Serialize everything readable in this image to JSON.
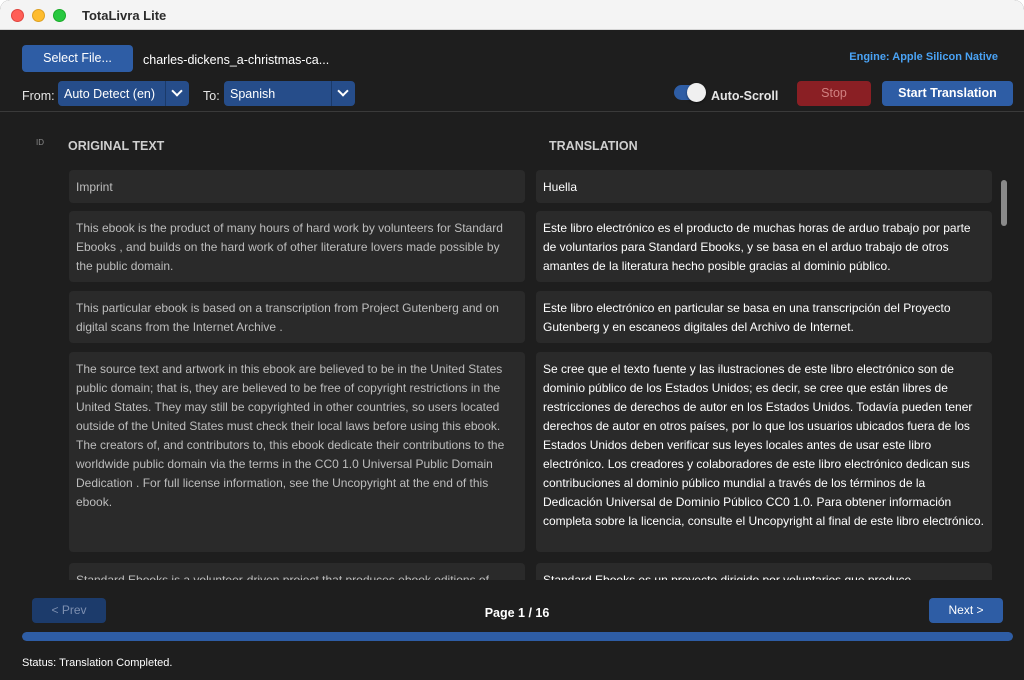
{
  "window": {
    "title": "TotaLivra Lite"
  },
  "toolbar": {
    "select_file_label": "Select File...",
    "filename": "charles-dickens_a-christmas-ca...",
    "engine_label": "Engine: Apple Silicon Native",
    "from_label": "From:",
    "from_value": "Auto Detect (en)",
    "to_label": "To:",
    "to_value": "Spanish",
    "autoscroll_label": "Auto-Scroll",
    "autoscroll_on": true,
    "stop_label": "Stop",
    "start_label": "Start Translation"
  },
  "table": {
    "id_header": "ID",
    "original_header": "ORIGINAL TEXT",
    "translation_header": "TRANSLATION",
    "rows": [
      {
        "original": "Imprint",
        "translation": "Huella"
      },
      {
        "original": "This ebook is the product of many hours of hard work by volunteers for Standard Ebooks , and builds on the hard work of other literature lovers made possible by the public domain.",
        "translation": "Este libro electrónico es el producto de muchas horas de arduo trabajo por parte de voluntarios para Standard Ebooks, y se basa en el arduo trabajo de otros amantes de la literatura hecho posible gracias al dominio público."
      },
      {
        "original": "This particular ebook is based on a transcription from Project Gutenberg and on digital scans from the Internet Archive .",
        "translation": "Este libro electrónico en particular se basa en una transcripción del Proyecto Gutenberg y en escaneos digitales del Archivo de Internet."
      },
      {
        "original": "The source text and artwork in this ebook are believed to be in the United States public domain; that is, they are believed to be free of copyright restrictions in the United States. They may still be copyrighted in other countries, so users located outside of the United States must check their local laws before using this ebook. The creators of, and contributors to, this ebook dedicate their contributions to the worldwide public domain via the terms in the CC0 1.0 Universal Public Domain Dedication . For full license information, see the Uncopyright at the end of this ebook.",
        "translation": "Se cree que el texto fuente y las ilustraciones de este libro electrónico son de dominio público de los Estados Unidos; es decir, se cree que están libres de restricciones de derechos de autor en los Estados Unidos. Todavía pueden tener derechos de autor en otros países, por lo que los usuarios ubicados fuera de los Estados Unidos deben verificar sus leyes locales antes de usar este libro electrónico. Los creadores y colaboradores de este libro electrónico dedican sus contribuciones al dominio público mundial a través de los términos de la Dedicación Universal de Dominio Público CC0 1.0. Para obtener información completa sobre la licencia, consulte el Uncopyright al final de este libro electrónico."
      },
      {
        "original": "Standard Ebooks is a volunteer-driven project that produces ebook editions of",
        "translation": "Standard Ebooks es un proyecto dirigido por voluntarios que produce"
      }
    ]
  },
  "pagination": {
    "prev_label": "< Prev",
    "page_text": "Page 1 / 16",
    "next_label": "Next >"
  },
  "progress": {
    "fraction": 1.0
  },
  "status": {
    "text": "Status: Translation Completed."
  },
  "colors": {
    "accent": "#2e5da5",
    "engine_text": "#4aa3f5",
    "stop": "#8a1f24",
    "background": "#1e1e1e",
    "cell": "#2a2a2a"
  }
}
